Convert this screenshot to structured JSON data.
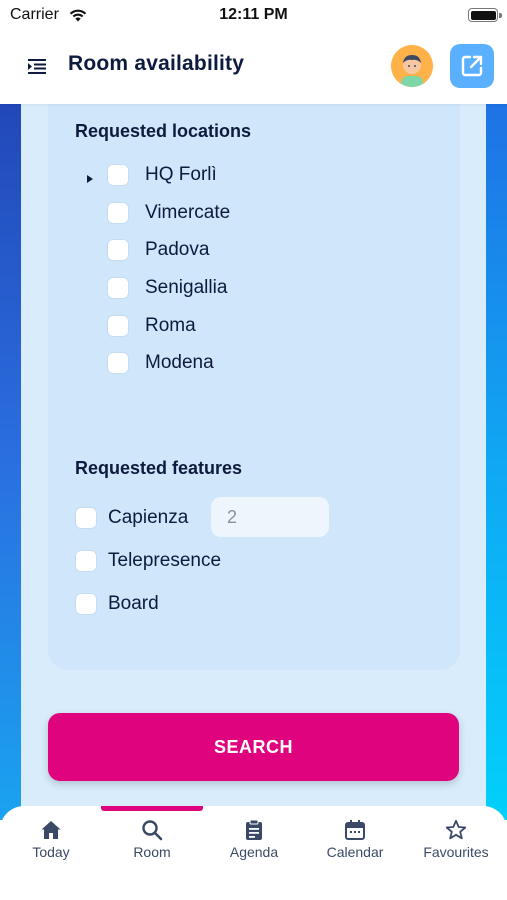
{
  "status_bar": {
    "carrier": "Carrier",
    "time": "12:11 PM"
  },
  "header": {
    "title": "Room availability",
    "icons": [
      "menu-icon",
      "avatar",
      "open-external-icon"
    ]
  },
  "locations": {
    "title": "Requested locations",
    "items": [
      {
        "label": "HQ Forlì",
        "checked": false,
        "expandable": true
      },
      {
        "label": "Vimercate",
        "checked": false
      },
      {
        "label": "Padova",
        "checked": false
      },
      {
        "label": "Senigallia",
        "checked": false
      },
      {
        "label": "Roma",
        "checked": false
      },
      {
        "label": "Modena",
        "checked": false
      }
    ]
  },
  "features": {
    "title": "Requested features",
    "items": [
      {
        "label": "Capienza",
        "checked": false
      },
      {
        "label": "Telepresence",
        "checked": false
      },
      {
        "label": "Board",
        "checked": false
      }
    ],
    "capacity_placeholder": "2"
  },
  "search_button": {
    "label": "SEARCH"
  },
  "tabbar": {
    "active": "Room",
    "tabs": [
      {
        "label": "Today",
        "icon": "home-icon"
      },
      {
        "label": "Room",
        "icon": "search-icon"
      },
      {
        "label": "Agenda",
        "icon": "clipboard-icon"
      },
      {
        "label": "Calendar",
        "icon": "calendar-icon"
      },
      {
        "label": "Favourites",
        "icon": "star-icon"
      }
    ]
  },
  "colors": {
    "accent": "#e0037e",
    "header_button": "#5ab0ff",
    "card": "#cfe6fb",
    "text": "#0d1b3e"
  }
}
